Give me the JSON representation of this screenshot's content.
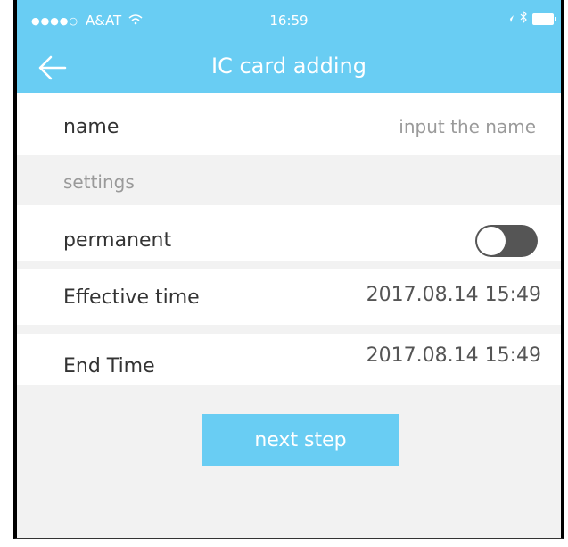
{
  "status_bar": {
    "signal": "●●●●○",
    "carrier": "A&AT",
    "wifi_icon": "wifi-icon",
    "time": "16:59",
    "location_icon": "location-arrow-icon",
    "bluetooth_icon": "bluetooth-icon",
    "battery_icon": "battery-icon"
  },
  "nav": {
    "back_icon": "back-arrow-icon",
    "title": "IC card adding"
  },
  "form": {
    "name_label": "name",
    "name_placeholder": "input the name",
    "settings_header": "settings",
    "permanent_label": "permanent",
    "permanent_on": false,
    "effective_label": "Effective time",
    "effective_value": "2017.08.14 15:49",
    "end_label": "End Time",
    "end_value": "2017.08.14 15:49"
  },
  "actions": {
    "next_label": "next step"
  },
  "colors": {
    "accent": "#69cdf3",
    "section_bg": "#f2f2f2",
    "toggle_off": "#555555"
  }
}
